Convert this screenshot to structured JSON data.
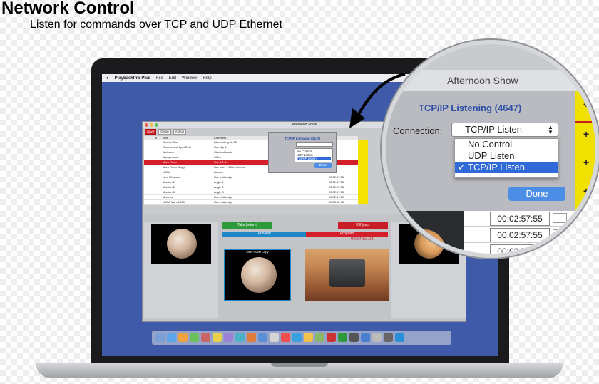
{
  "header": {
    "title": "Network Control",
    "subtitle": "Listen for commands over TCP and UDP Ethernet"
  },
  "menubar": {
    "app_name": "PlaybackPro Plus",
    "items": [
      "File",
      "Edit",
      "Window",
      "Help"
    ]
  },
  "app_window": {
    "title": "Afternoon Show",
    "toolbar": [
      "Save",
      "Close",
      "Action"
    ],
    "cue_columns": [
      "#",
      "Title",
      "Comment"
    ],
    "cues": [
      {
        "title": "Sunrise One",
        "comment": "take ending at :05",
        "duration": ""
      },
      {
        "title": "Commercial Spot Reel",
        "comment": "Use clip 4",
        "duration": ""
      },
      {
        "title": "Welcome",
        "comment": "Starts at black",
        "duration": ""
      },
      {
        "title": "Background",
        "comment": "CHee",
        "duration": ""
      },
      {
        "title": "Mars Rover",
        "comment": "Use 4:1:54",
        "duration": ""
      },
      {
        "title": "Mars Rover Copy",
        "comment": "Use after 1:30 to the end",
        "duration": ""
      },
      {
        "title": "NASA",
        "comment": "Launch",
        "duration": ""
      },
      {
        "title": "New Missions",
        "comment": "Use entire clip",
        "duration": "00:02:57:55"
      },
      {
        "title": "Mission 1",
        "comment": "Angle 1",
        "duration": "00:02:57:55"
      },
      {
        "title": "Mission 2",
        "comment": "Angle 2",
        "duration": "00:02:57:55"
      },
      {
        "title": "Mission 3",
        "comment": "Angle 3",
        "duration": "00:02:57:55"
      },
      {
        "title": "Microbot",
        "comment": "Use entire clip",
        "duration": "00:02:57:55"
      },
      {
        "title": "NASA Mars 1095",
        "comment": "Use entire clip",
        "duration": "00:03:12:45"
      }
    ],
    "take_label": "Take (return)",
    "kill_label": "Kill (esc)",
    "preview_label": "Preview",
    "program_label": "Program",
    "timer": "00:04:53:28",
    "preview_clip": "Mars Rover Copy",
    "left_clip": "Mars Rover Copy"
  },
  "dialog": {
    "window_title": "Afternoon Show",
    "title": "TCP/IP Listening (4647)",
    "connection_label": "Connection:",
    "selected": "TCP/IP Listen",
    "options": [
      "No Control",
      "UDP Listen",
      "TCP/IP Listen"
    ],
    "checkmark": "✓",
    "done_label": "Done",
    "times": [
      "00:02:57:55",
      "00:02:57:55",
      "00:02:57:55"
    ],
    "plus_marks": [
      "+",
      "+",
      "+",
      "+"
    ]
  },
  "colors": {
    "desktop": "#3e5aa8",
    "accent_blue": "#2f6ad8",
    "dialog_title": "#2f4fa8",
    "take_green": "#2e9a3c",
    "kill_red": "#c91d26",
    "yellow_col": "#f1e100"
  }
}
